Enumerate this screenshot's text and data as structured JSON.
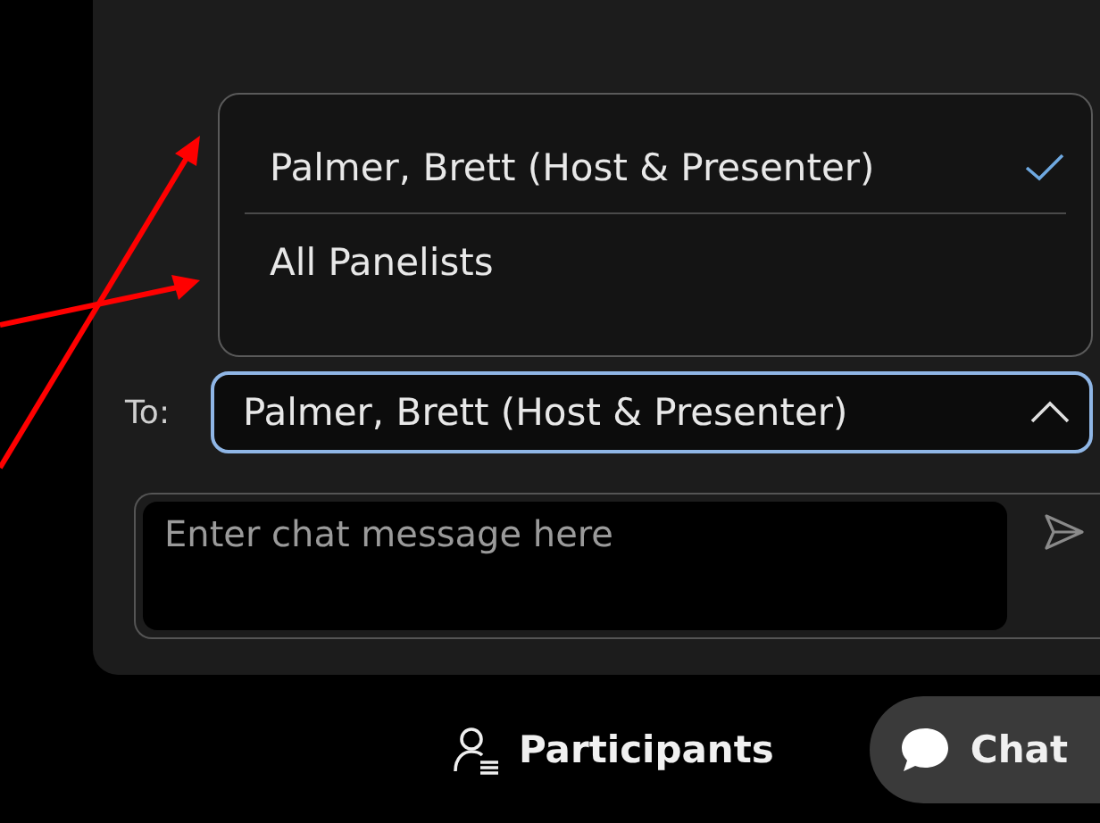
{
  "recipient_menu": {
    "items": [
      {
        "label": "Palmer, Brett (Host & Presenter)",
        "selected": true
      },
      {
        "label": "All Panelists",
        "selected": false
      }
    ]
  },
  "recipient": {
    "label": "To:",
    "value": "Palmer, Brett (Host & Presenter)",
    "expanded": true
  },
  "message": {
    "placeholder": "Enter chat message here"
  },
  "bottom_tabs": [
    {
      "label": "Participants",
      "kind": "participants",
      "selected": false
    },
    {
      "label": "Chat",
      "kind": "chat",
      "selected": true
    }
  ]
}
